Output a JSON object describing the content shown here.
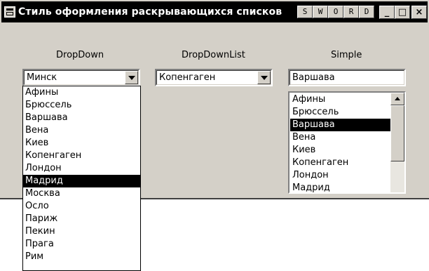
{
  "window": {
    "title": "Стиль оформления раскрывающихся списков",
    "extra_buttons": [
      "S",
      "W",
      "O",
      "R",
      "D"
    ],
    "controls": {
      "minimize": "_",
      "maximize": "□",
      "close": "×"
    }
  },
  "dropdown": {
    "label": "DropDown",
    "value": "Минск",
    "items": [
      "Афины",
      "Брюссель",
      "Варшава",
      "Вена",
      "Киев",
      "Копенгаген",
      "Лондон",
      "Мадрид",
      "Москва",
      "Осло",
      "Париж",
      "Пекин",
      "Прага",
      "Рим"
    ],
    "selected_item": "Мадрид"
  },
  "dropdownlist": {
    "label": "DropDownList",
    "value": "Копенгаген"
  },
  "simple": {
    "label": "Simple",
    "value": "Варшава",
    "items": [
      "Афины",
      "Брюссель",
      "Варшава",
      "Вена",
      "Киев",
      "Копенгаген",
      "Лондон",
      "Мадрид"
    ],
    "selected_item": "Варшава"
  }
}
